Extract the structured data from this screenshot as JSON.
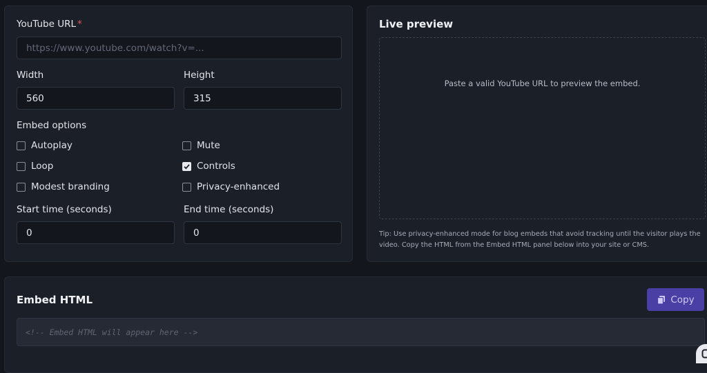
{
  "form": {
    "url_label": "YouTube URL",
    "url_required": "*",
    "url_placeholder": "https://www.youtube.com/watch?v=...",
    "url_value": "",
    "width_label": "Width",
    "width_value": "560",
    "height_label": "Height",
    "height_value": "315",
    "options_label": "Embed options",
    "options": [
      {
        "label": "Autoplay",
        "checked": false
      },
      {
        "label": "Mute",
        "checked": false
      },
      {
        "label": "Loop",
        "checked": false
      },
      {
        "label": "Controls",
        "checked": true
      },
      {
        "label": "Modest branding",
        "checked": false
      },
      {
        "label": "Privacy-enhanced",
        "checked": false
      }
    ],
    "start_label": "Start time (seconds)",
    "start_value": "0",
    "end_label": "End time (seconds)",
    "end_value": "0"
  },
  "preview": {
    "title": "Live preview",
    "message": "Paste a valid YouTube URL to preview the embed.",
    "tip": "Tip: Use privacy-enhanced mode for blog embeds that avoid tracking until the visitor plays the video. Copy the HTML from the Embed HTML panel below into your site or CMS."
  },
  "embed": {
    "title": "Embed HTML",
    "copy_label": "Copy",
    "copy_icon": "copy-icon",
    "placeholder": "<!-- Embed HTML will appear here -->"
  },
  "colors": {
    "accent": "#4a3fa4",
    "background": "#13161d",
    "panel": "#1b1f28",
    "required": "#e05858"
  }
}
